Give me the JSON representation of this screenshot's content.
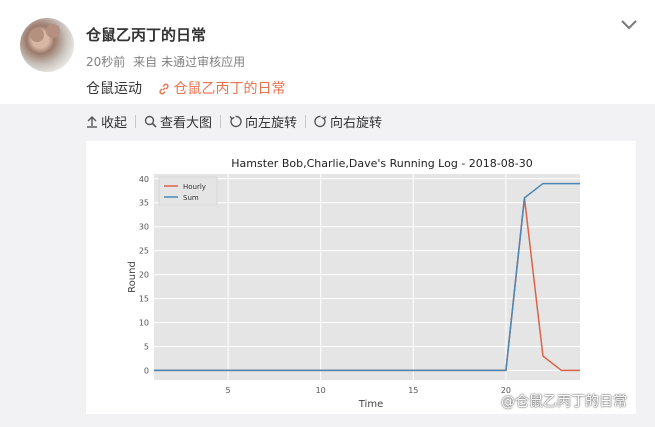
{
  "post": {
    "username": "仓鼠乙丙丁的日常",
    "time": "20秒前",
    "source_prefix": "来自",
    "source": "未通过审核应用",
    "text": "仓鼠运动",
    "link_text": "仓鼠乙丙丁的日常",
    "link_color": "#eb7350"
  },
  "toolbar": {
    "collapse": "收起",
    "view_large": "查看大图",
    "rotate_left": "向左旋转",
    "rotate_right": "向右旋转"
  },
  "watermark": "@仓鼠乙丙丁的日常",
  "icons": [
    "collapse-icon",
    "magnifier-icon",
    "rotate-left-icon",
    "rotate-right-icon",
    "link-icon",
    "chevron-down-icon",
    "weibo-icon"
  ],
  "chart_data": {
    "type": "line",
    "title": "Hamster Bob,Charlie,Dave's Running Log - 2018-08-30",
    "xlabel": "Time",
    "ylabel": "Round",
    "xlim": [
      1,
      24
    ],
    "ylim": [
      -2,
      41
    ],
    "xticks": [
      5,
      10,
      15,
      20
    ],
    "yticks": [
      0,
      5,
      10,
      15,
      20,
      25,
      30,
      35,
      40
    ],
    "grid": true,
    "legend_position": "top-left",
    "x": [
      1,
      2,
      3,
      4,
      5,
      6,
      7,
      8,
      9,
      10,
      11,
      12,
      13,
      14,
      15,
      16,
      17,
      18,
      19,
      20,
      21,
      22,
      23,
      24
    ],
    "series": [
      {
        "name": "Hourly",
        "color": "#d9644a",
        "values": [
          0,
          0,
          0,
          0,
          0,
          0,
          0,
          0,
          0,
          0,
          0,
          0,
          0,
          0,
          0,
          0,
          0,
          0,
          0,
          0,
          36,
          3,
          0,
          0
        ]
      },
      {
        "name": "Sum",
        "color": "#4b86b4",
        "values": [
          0,
          0,
          0,
          0,
          0,
          0,
          0,
          0,
          0,
          0,
          0,
          0,
          0,
          0,
          0,
          0,
          0,
          0,
          0,
          0,
          36,
          39,
          39,
          39
        ]
      }
    ]
  }
}
